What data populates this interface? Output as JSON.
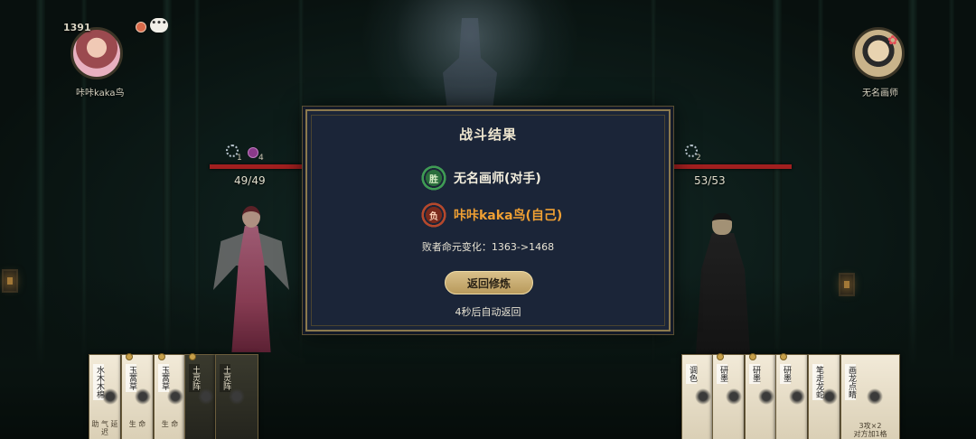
{
  "player_self": {
    "rating": "1391",
    "name": "咔咔kaka鸟",
    "chat_icon": "chat-bubble",
    "emote_icon": "smile-face"
  },
  "player_opponent": {
    "name": "无名画师"
  },
  "battle": {
    "self_hp": "49/49",
    "self_badge_a": "1",
    "self_badge_b": "4",
    "opp_hp": "53/53",
    "opp_badge": "2"
  },
  "result_dialog": {
    "title": "战斗结果",
    "winner_badge": "胜",
    "winner_text": "无名画师(对手)",
    "loser_badge": "负",
    "loser_text": "咔咔kaka鸟(自己)",
    "rating_change": "败者命元变化：1363->1468",
    "return_button": "返回修炼",
    "countdown": "4秒后自动返回"
  },
  "hand_left": [
    {
      "label": "水木木棉",
      "text": "助\n气\n延迟"
    },
    {
      "label": "玉蒿草",
      "text": "生\n命"
    },
    {
      "label": "玉蒿草",
      "text": "生\n命"
    },
    {
      "label": "土灵阵",
      "text": ""
    },
    {
      "label": "土灵阵",
      "text": ""
    }
  ],
  "hand_right": [
    {
      "label": "调色",
      "text": ""
    },
    {
      "label": "研墨",
      "text": ""
    },
    {
      "label": "研墨",
      "text": ""
    },
    {
      "label": "研墨",
      "text": ""
    },
    {
      "label": "笔走龙蛇",
      "text": ""
    },
    {
      "label": "画龙点睛",
      "text": "3攻×2\n对方加1格"
    }
  ],
  "colors": {
    "hp_bar": "#a11f1f",
    "win_accent": "#3f9b54",
    "lose_accent": "#f0a033",
    "dialog_border": "#8c7a4e",
    "button_gold": "#d9c08a"
  }
}
